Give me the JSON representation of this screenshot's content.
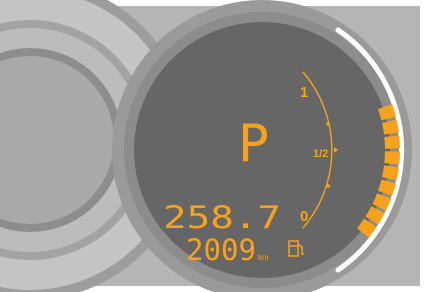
{
  "gear": "P",
  "trip": "258.7",
  "odometer": "2009",
  "odometer_unit": "km",
  "fuel_gauge": {
    "scale_labels": [
      "0",
      "1/2",
      "1"
    ],
    "level_fraction": 0.75
  },
  "colors": {
    "display_amber": "#f7a21b",
    "display_bg": "#6a6a6a",
    "bezel": "#a6a6a6",
    "bezel_light": "#c9c9c9",
    "arc_white": "#ffffff"
  },
  "icons": [
    "fuel-pump-icon"
  ]
}
